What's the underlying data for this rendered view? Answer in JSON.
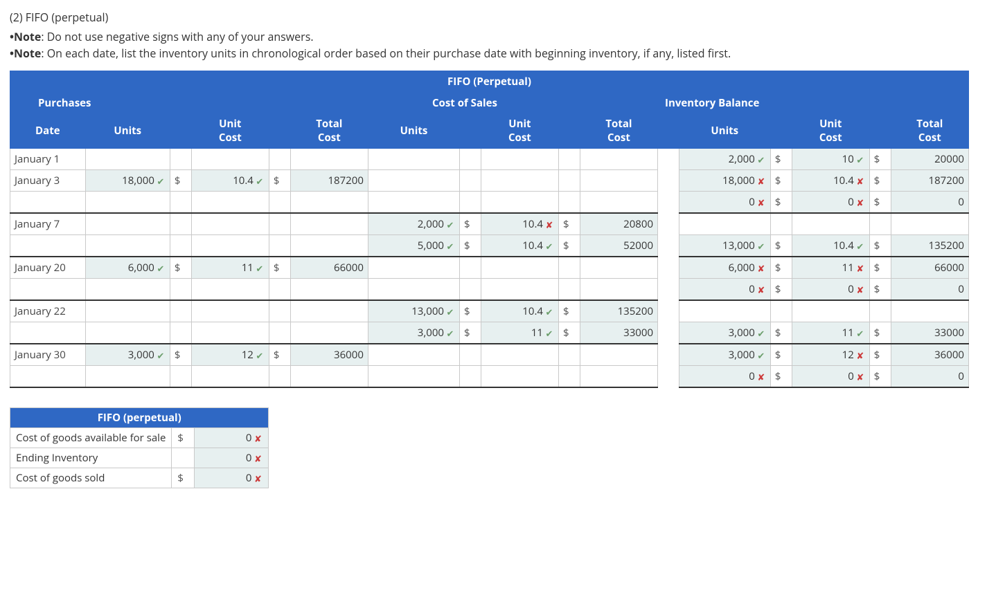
{
  "title": "(2) FIFO (perpetual)",
  "notes": [
    "Do not use negative signs with any of your answers.",
    "On each date, list the inventory units in chronological order based on their purchase date with beginning inventory, if any, listed first."
  ],
  "note_label": "Note",
  "headers": {
    "top": "FIFO (Perpetual)",
    "group_purchases": "Purchases",
    "group_cos": "Cost of Sales",
    "group_inv": "Inventory Balance",
    "date": "Date",
    "units": "Units",
    "unit_cost": "Unit\nCost",
    "total_cost": "Total\nCost"
  },
  "rows": [
    {
      "date": "January 1",
      "p_units": null,
      "p_unit": null,
      "p_tot": null,
      "c_units": null,
      "c_unit": null,
      "c_tot": null,
      "i_units": "2,000",
      "i_units_m": "ok",
      "i_unit": "10",
      "i_unit_m": "ok",
      "i_tot": "20000",
      "sep": false
    },
    {
      "date": "January 3",
      "p_units": "18,000",
      "p_units_m": "ok",
      "p_unit": "10.4",
      "p_unit_m": "ok",
      "p_tot": "187200",
      "c_units": null,
      "c_unit": null,
      "c_tot": null,
      "i_units": "18,000",
      "i_units_m": "bad",
      "i_unit": "10.4",
      "i_unit_m": "bad",
      "i_tot": "187200",
      "sep": false
    },
    {
      "date": "",
      "p_units": null,
      "p_unit": null,
      "p_tot": null,
      "c_units": null,
      "c_unit": null,
      "c_tot": null,
      "i_units": "0",
      "i_units_m": "bad",
      "i_unit": "0",
      "i_unit_m": "bad",
      "i_tot": "0",
      "sep": true
    },
    {
      "date": "January 7",
      "p_units": null,
      "p_unit": null,
      "p_tot": null,
      "c_units": "2,000",
      "c_units_m": "ok",
      "c_unit": "10.4",
      "c_unit_m": "bad",
      "c_tot": "20800",
      "i_units": null,
      "i_unit": null,
      "i_tot": null,
      "sep": false
    },
    {
      "date": "",
      "p_units": null,
      "p_unit": null,
      "p_tot": null,
      "c_units": "5,000",
      "c_units_m": "ok",
      "c_unit": "10.4",
      "c_unit_m": "ok",
      "c_tot": "52000",
      "i_units": "13,000",
      "i_units_m": "ok",
      "i_unit": "10.4",
      "i_unit_m": "ok",
      "i_tot": "135200",
      "sep": true
    },
    {
      "date": "January 20",
      "p_units": "6,000",
      "p_units_m": "ok",
      "p_unit": "11",
      "p_unit_m": "ok",
      "p_tot": "66000",
      "c_units": null,
      "c_unit": null,
      "c_tot": null,
      "i_units": "6,000",
      "i_units_m": "bad",
      "i_unit": "11",
      "i_unit_m": "bad",
      "i_tot": "66000",
      "sep": false
    },
    {
      "date": "",
      "p_units": null,
      "p_unit": null,
      "p_tot": null,
      "c_units": null,
      "c_unit": null,
      "c_tot": null,
      "i_units": "0",
      "i_units_m": "bad",
      "i_unit": "0",
      "i_unit_m": "bad",
      "i_tot": "0",
      "sep": true
    },
    {
      "date": "January 22",
      "p_units": null,
      "p_unit": null,
      "p_tot": null,
      "c_units": "13,000",
      "c_units_m": "ok",
      "c_unit": "10.4",
      "c_unit_m": "ok",
      "c_tot": "135200",
      "i_units": null,
      "i_unit": null,
      "i_tot": null,
      "sep": false
    },
    {
      "date": "",
      "p_units": null,
      "p_unit": null,
      "p_tot": null,
      "c_units": "3,000",
      "c_units_m": "ok",
      "c_unit": "11",
      "c_unit_m": "ok",
      "c_tot": "33000",
      "i_units": "3,000",
      "i_units_m": "ok",
      "i_unit": "11",
      "i_unit_m": "ok",
      "i_tot": "33000",
      "sep": true
    },
    {
      "date": "January 30",
      "p_units": "3,000",
      "p_units_m": "ok",
      "p_unit": "12",
      "p_unit_m": "ok",
      "p_tot": "36000",
      "c_units": null,
      "c_unit": null,
      "c_tot": null,
      "i_units": "3,000",
      "i_units_m": "ok",
      "i_unit": "12",
      "i_unit_m": "bad",
      "i_tot": "36000",
      "sep": false
    },
    {
      "date": "",
      "p_units": null,
      "p_unit": null,
      "p_tot": null,
      "c_units": null,
      "c_unit": null,
      "c_tot": null,
      "i_units": "0",
      "i_units_m": "bad",
      "i_unit": "0",
      "i_unit_m": "bad",
      "i_tot": "0",
      "sep": true
    }
  ],
  "summary": {
    "title": "FIFO (perpetual)",
    "rows": [
      {
        "label": "Cost of goods available for sale",
        "currency": "$",
        "value": "0",
        "mark": "bad"
      },
      {
        "label": "Ending Inventory",
        "currency": "",
        "value": "0",
        "mark": "bad"
      },
      {
        "label": "Cost of goods sold",
        "currency": "$",
        "value": "0",
        "mark": "bad"
      }
    ]
  }
}
